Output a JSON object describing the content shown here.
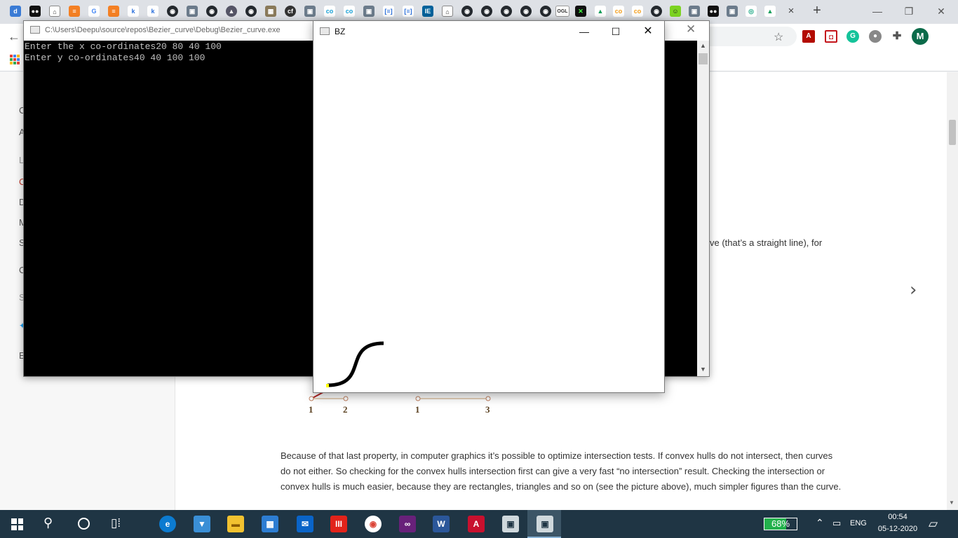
{
  "console": {
    "title": "C:\\Users\\Deepu\\source\\repos\\Bezier_curve\\Debug\\Bezier_curve.exe",
    "lines": [
      "Enter the x co-ordinates20 80 40 100",
      "Enter y co-ordinates40 40 100 100"
    ]
  },
  "bz_window": {
    "title": "BZ",
    "curve": {
      "x": [
        20,
        80,
        40,
        100
      ],
      "y": [
        40,
        40,
        100,
        100
      ],
      "color": "#000000",
      "start_marker_color": "#ffff00"
    }
  },
  "page": {
    "nav_letters": [
      "C",
      "A",
      "L",
      "C",
      "D",
      "M",
      "S",
      "C",
      "S",
      "E"
    ],
    "partial_line": "ve (that’s a straight line), for",
    "figure_labels": [
      "1",
      "2",
      "1",
      "3"
    ],
    "paragraph": "Because of that last property, in computer graphics it’s possible to optimize intersection tests. If convex hulls do not intersect, then curves do not either. So checking for the convex hulls intersection first can give a very fast “no intersection” result. Checking the intersection or convex hulls is much easier, because they are rectangles, triangles and so on (see the picture above), much simpler figures than the curve."
  },
  "browser": {
    "tab_close": "×",
    "new_tab": "+",
    "profile_initial": "M"
  },
  "taskbar": {
    "battery_percent": "68%",
    "battery_level": 0.68,
    "language": "ENG",
    "time": "00:54",
    "date": "05-12-2020"
  }
}
